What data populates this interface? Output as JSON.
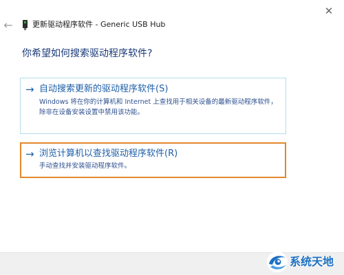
{
  "window": {
    "title": "更新驱动程序软件 - Generic USB Hub",
    "close_glyph": "✕",
    "back_glyph": "←"
  },
  "question": "你希望如何搜索驱动程序软件?",
  "options": [
    {
      "arrow": "→",
      "title": "自动搜索更新的驱动程序软件(S)",
      "description": "Windows 将在你的计算机和 Internet 上查找用于相关设备的最新驱动程序软件，除非在设备安装设置中禁用该功能。"
    },
    {
      "arrow": "→",
      "title": "浏览计算机以查找驱动程序软件(R)",
      "description": "手动查找并安装驱动程序软件。"
    }
  ],
  "watermark": {
    "text": "系统天地"
  },
  "colors": {
    "link_blue": "#1e5fa8",
    "heading_blue": "#1a3a78",
    "option_border": "#b4dde8",
    "highlight_orange": "#e2872a",
    "footer_bg": "#f0f0f0"
  },
  "icons": {
    "close": "close-icon",
    "back": "back-arrow-icon",
    "device": "usb-device-icon",
    "option_arrow": "arrow-right-icon"
  }
}
